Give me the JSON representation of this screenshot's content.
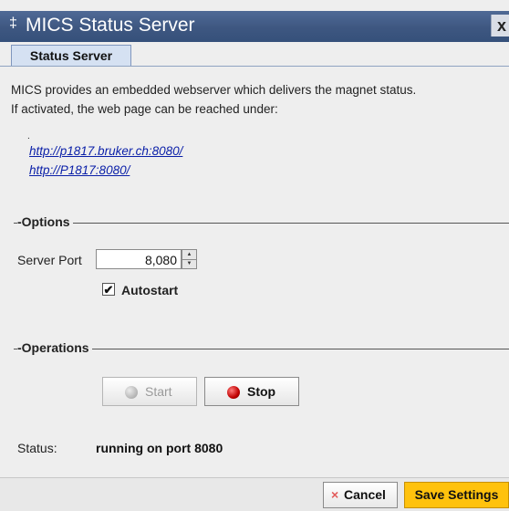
{
  "window": {
    "title": "MICS Status Server",
    "title_icon_glyph": "‡",
    "close_glyph": "x"
  },
  "tabs": [
    {
      "label": "Status Server",
      "selected": true
    }
  ],
  "description": {
    "line1": "MICS provides an embedded webserver which delivers the magnet status.",
    "line2": "If activated, the web page can be reached under:"
  },
  "links": [
    "http://p1817.bruker.ch:8080/",
    "http://P1817:8080/"
  ],
  "options": {
    "section_label": "Options",
    "server_port_label": "Server Port",
    "server_port_value": "8,080",
    "autostart_label": "Autostart",
    "autostart_checked": true,
    "check_glyph": "✔"
  },
  "operations": {
    "section_label": "Operations",
    "start_label": "Start",
    "start_enabled": false,
    "stop_label": "Stop"
  },
  "status": {
    "label": "Status:",
    "value": "running on port 8080"
  },
  "footer": {
    "cancel_glyph": "×",
    "cancel_label": "Cancel",
    "save_label": "Save Settings"
  },
  "colors": {
    "title_bar": "#3e5781",
    "link": "#0a1fa8",
    "save_button": "#ffc20d",
    "stop_indicator": "#c00000"
  }
}
